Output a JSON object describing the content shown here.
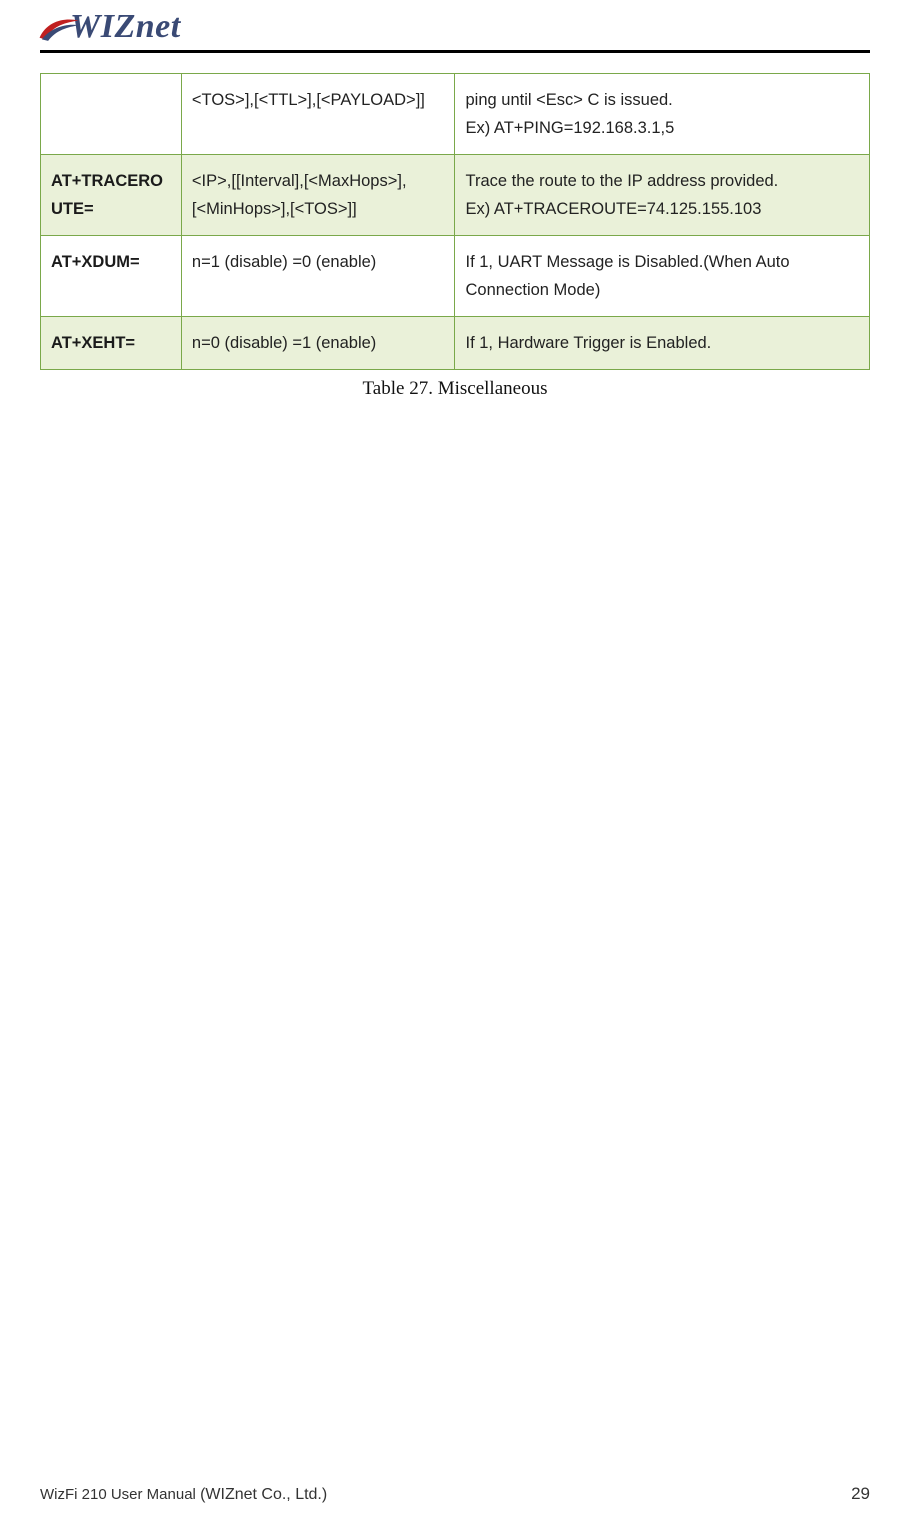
{
  "header": {
    "logo_text": "WIZnet"
  },
  "table": {
    "rows": [
      {
        "cmd": "",
        "param": "<TOS>],[<TTL>],[<PAYLOAD>]]",
        "desc": "ping until <Esc> C is issued.\nEx) AT+PING=192.168.3.1,5",
        "shade": false
      },
      {
        "cmd": "AT+TRACEROUTE=",
        "param": "<IP>,[[Interval],[<MaxHops>],[<MinHops>],[<TOS>]]",
        "desc": "Trace the route to the IP address provided.\nEx) AT+TRACEROUTE=74.125.155.103",
        "shade": true
      },
      {
        "cmd": "AT+XDUM=",
        "param": "n=1 (disable) =0 (enable)",
        "desc": "If 1, UART Message is Disabled.(When Auto Connection Mode)",
        "shade": false
      },
      {
        "cmd": "AT+XEHT=",
        "param": "n=0 (disable) =1 (enable)",
        "desc": "If 1, Hardware Trigger is Enabled.",
        "shade": true
      }
    ]
  },
  "caption": "Table 27. Miscellaneous",
  "footer": {
    "left_manual": "WizFi 210 User Manual ",
    "left_company": "(WIZnet Co., Ltd.)",
    "page_number": "29"
  }
}
